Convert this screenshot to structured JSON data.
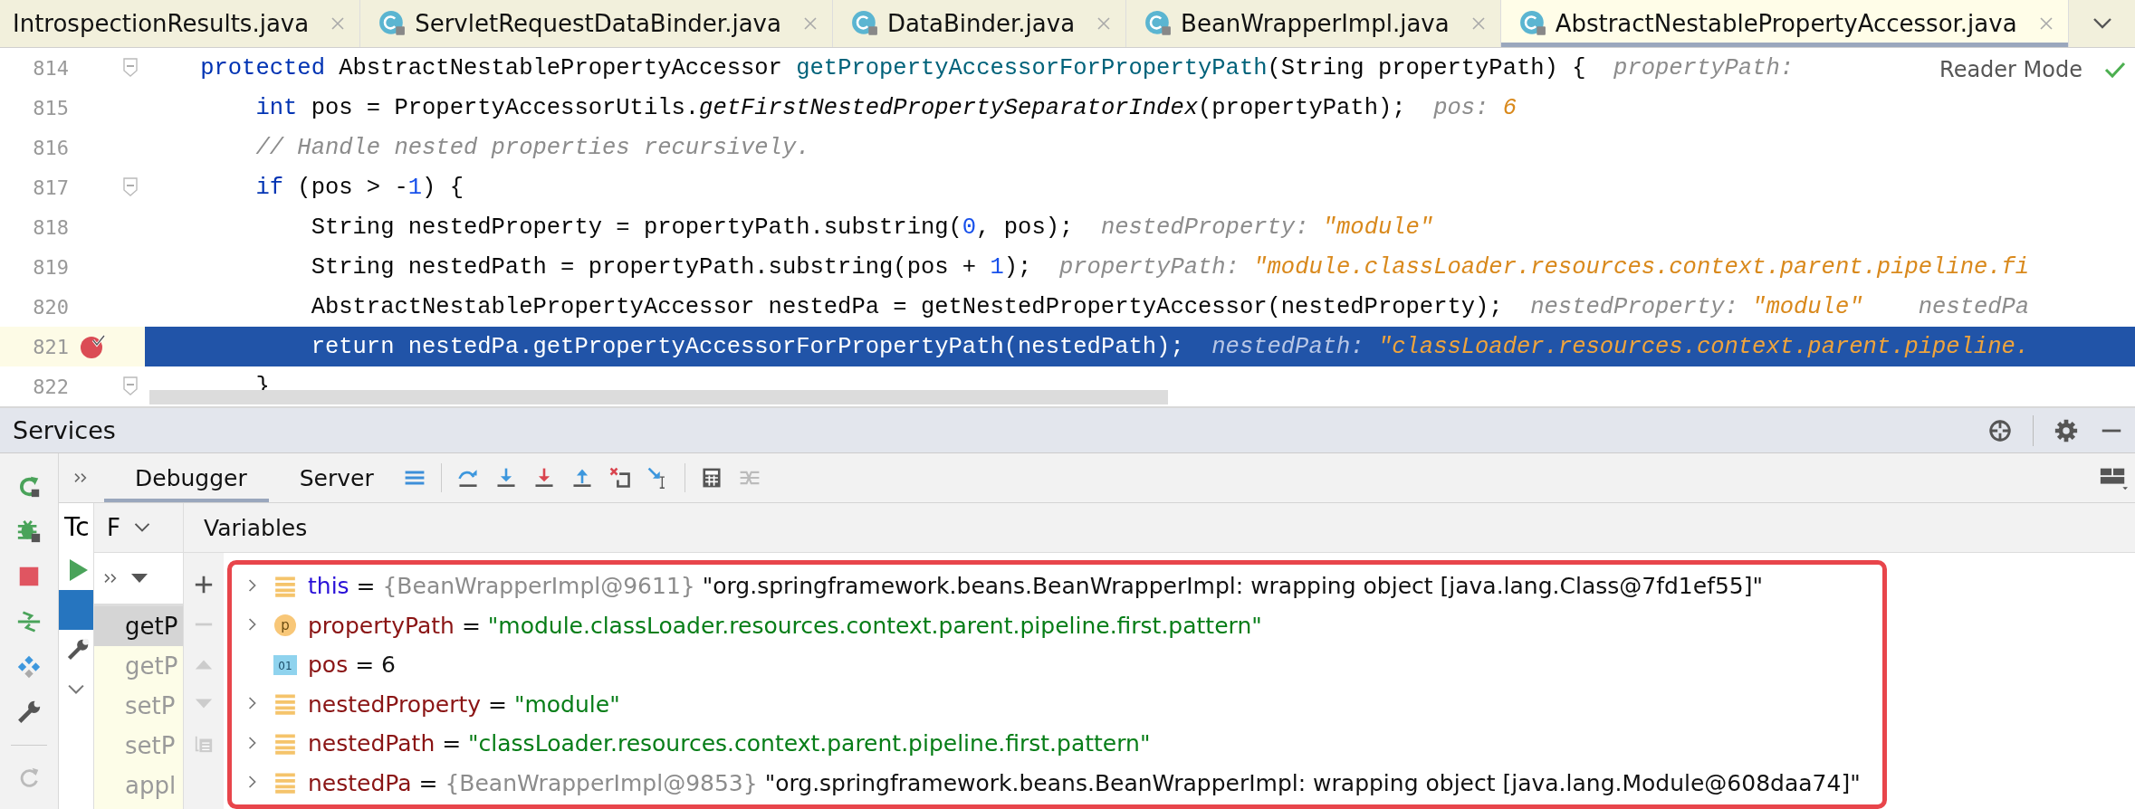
{
  "editor_tabs": [
    {
      "label": "IntrospectionResults.java",
      "class_icon": false,
      "selected": false
    },
    {
      "label": "ServletRequestDataBinder.java",
      "class_icon": true,
      "selected": false
    },
    {
      "label": "DataBinder.java",
      "class_icon": true,
      "selected": false
    },
    {
      "label": "BeanWrapperImpl.java",
      "class_icon": true,
      "selected": false
    },
    {
      "label": "AbstractNestablePropertyAccessor.java",
      "class_icon": true,
      "selected": true
    }
  ],
  "reader_mode": "Reader Mode",
  "code_lines": [
    {
      "number": "814",
      "fold": true,
      "breakpoint": false,
      "current": false,
      "tokens": [
        {
          "text": "    protected",
          "kind": "keyword"
        },
        {
          "text": " AbstractNestablePropertyAccessor ",
          "kind": "plain"
        },
        {
          "text": "getPropertyAccessorForPropertyPath",
          "kind": "decl"
        },
        {
          "text": "(String propertyPath) {",
          "kind": "plain"
        },
        {
          "text": "  propertyPath:",
          "kind": "hint-name"
        }
      ]
    },
    {
      "number": "815",
      "fold": false,
      "breakpoint": false,
      "current": false,
      "tokens": [
        {
          "text": "        int",
          "kind": "keyword"
        },
        {
          "text": " pos = PropertyAccessorUtils.",
          "kind": "plain"
        },
        {
          "text": "getFirstNestedPropertySeparatorIndex",
          "kind": "static"
        },
        {
          "text": "(propertyPath);",
          "kind": "plain"
        },
        {
          "text": "  pos: ",
          "kind": "hint-name"
        },
        {
          "text": "6",
          "kind": "hint-value"
        }
      ]
    },
    {
      "number": "816",
      "fold": false,
      "breakpoint": false,
      "current": false,
      "tokens": [
        {
          "text": "        // Handle nested properties recursively.",
          "kind": "comment"
        }
      ]
    },
    {
      "number": "817",
      "fold": true,
      "breakpoint": false,
      "current": false,
      "tokens": [
        {
          "text": "        if",
          "kind": "keyword"
        },
        {
          "text": " (pos > -",
          "kind": "plain"
        },
        {
          "text": "1",
          "kind": "number"
        },
        {
          "text": ") {",
          "kind": "plain"
        }
      ]
    },
    {
      "number": "818",
      "fold": false,
      "breakpoint": false,
      "current": false,
      "tokens": [
        {
          "text": "            String nestedProperty = propertyPath.substring(",
          "kind": "plain"
        },
        {
          "text": "0",
          "kind": "number"
        },
        {
          "text": ", pos);",
          "kind": "plain"
        },
        {
          "text": "  nestedProperty: ",
          "kind": "hint-name"
        },
        {
          "text": "\"module\"",
          "kind": "hint-value"
        }
      ]
    },
    {
      "number": "819",
      "fold": false,
      "breakpoint": false,
      "current": false,
      "tokens": [
        {
          "text": "            String nestedPath = propertyPath.substring(pos + ",
          "kind": "plain"
        },
        {
          "text": "1",
          "kind": "number"
        },
        {
          "text": ");",
          "kind": "plain"
        },
        {
          "text": "  propertyPath: ",
          "kind": "hint-name"
        },
        {
          "text": "\"module.classLoader.resources.context.parent.pipeline.fi",
          "kind": "hint-value"
        }
      ]
    },
    {
      "number": "820",
      "fold": false,
      "breakpoint": false,
      "current": false,
      "tokens": [
        {
          "text": "            AbstractNestablePropertyAccessor nestedPa = getNestedPropertyAccessor(nestedProperty);",
          "kind": "plain"
        },
        {
          "text": "  nestedProperty: ",
          "kind": "hint-name"
        },
        {
          "text": "\"module\"",
          "kind": "hint-value"
        },
        {
          "text": "    nestedPa",
          "kind": "hint-name"
        }
      ]
    },
    {
      "number": "821",
      "fold": false,
      "breakpoint": true,
      "current": true,
      "tokens": [
        {
          "text": "            return",
          "kind": "keyword"
        },
        {
          "text": " nestedPa.getPropertyAccessorForPropertyPath(nestedPath);",
          "kind": "plain"
        },
        {
          "text": "  nestedPath: ",
          "kind": "hint-name"
        },
        {
          "text": "\"classLoader.resources.context.parent.pipeline.",
          "kind": "hint-value"
        }
      ]
    },
    {
      "number": "822",
      "fold": true,
      "breakpoint": false,
      "current": false,
      "tokens": [
        {
          "text": "        }",
          "kind": "plain"
        }
      ]
    }
  ],
  "services": {
    "title": "Services",
    "debugger_tabs": [
      {
        "label": "Debugger",
        "selected": true
      },
      {
        "label": "Server",
        "selected": false
      }
    ],
    "tree_label": "Tc",
    "tree_rows": [
      {
        "kind": "run",
        "selected": false
      },
      {
        "kind": "blank",
        "selected": true
      },
      {
        "kind": "tool",
        "selected": false
      },
      {
        "kind": "chevron",
        "selected": false
      }
    ],
    "frames_header": "F",
    "frames": [
      {
        "label": "getP",
        "selected": true,
        "library": false
      },
      {
        "label": "getP",
        "selected": false,
        "library": true
      },
      {
        "label": "setP",
        "selected": false,
        "library": true
      },
      {
        "label": "setP",
        "selected": false,
        "library": true
      },
      {
        "label": "appl",
        "selected": false,
        "library": true
      }
    ],
    "variables_header": "Variables",
    "variables": [
      {
        "kind": "field",
        "expandable": true,
        "tokens": [
          {
            "text": "this",
            "kind": "keyword"
          },
          {
            "text": " = ",
            "kind": "plain"
          },
          {
            "text": "{BeanWrapperImpl@9611} ",
            "kind": "ref"
          },
          {
            "text": "\"org.springframework.beans.BeanWrapperImpl: wrapping object [java.lang.Class@7fd1ef55]\"",
            "kind": "plain"
          }
        ]
      },
      {
        "kind": "param",
        "badge": "p",
        "expandable": true,
        "tokens": [
          {
            "text": "propertyPath",
            "kind": "name"
          },
          {
            "text": " = ",
            "kind": "plain"
          },
          {
            "text": "\"module.classLoader.resources.context.parent.pipeline.first.pattern\"",
            "kind": "string"
          }
        ]
      },
      {
        "kind": "primitive",
        "badge": "01",
        "expandable": false,
        "tokens": [
          {
            "text": "pos",
            "kind": "name"
          },
          {
            "text": " = ",
            "kind": "plain"
          },
          {
            "text": "6",
            "kind": "plain"
          }
        ]
      },
      {
        "kind": "field",
        "expandable": true,
        "tokens": [
          {
            "text": "nestedProperty",
            "kind": "name"
          },
          {
            "text": " = ",
            "kind": "plain"
          },
          {
            "text": "\"module\"",
            "kind": "string"
          }
        ]
      },
      {
        "kind": "field",
        "expandable": true,
        "tokens": [
          {
            "text": "nestedPath",
            "kind": "name"
          },
          {
            "text": " = ",
            "kind": "plain"
          },
          {
            "text": "\"classLoader.resources.context.parent.pipeline.first.pattern\"",
            "kind": "string"
          }
        ]
      },
      {
        "kind": "field",
        "expandable": true,
        "tokens": [
          {
            "text": "nestedPa",
            "kind": "name"
          },
          {
            "text": " = ",
            "kind": "plain"
          },
          {
            "text": "{BeanWrapperImpl@9853} ",
            "kind": "ref"
          },
          {
            "text": "\"org.springframework.beans.BeanWrapperImpl: wrapping object [java.lang.Module@608daa74]\"",
            "kind": "plain"
          }
        ]
      }
    ]
  }
}
